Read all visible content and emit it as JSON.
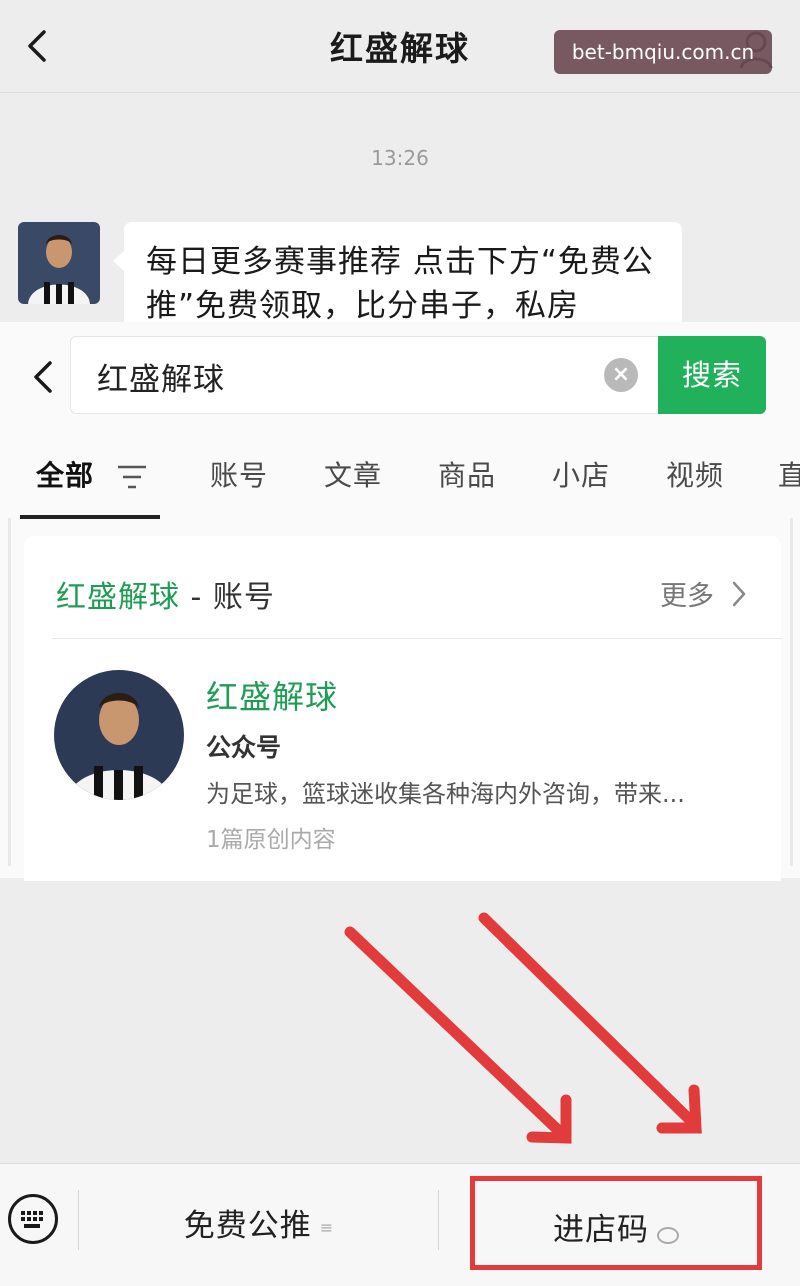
{
  "header": {
    "title": "红盛解球",
    "watermark": "bet-bmqiu.com.cn"
  },
  "chat": {
    "time": "13:26",
    "message": "每日更多赛事推荐 点击下方“免费公推”免费领取，比分串子，私房"
  },
  "search": {
    "query": "红盛解球",
    "clear_icon": "×",
    "button_label": "搜索",
    "tabs": [
      "全部",
      "账号",
      "文章",
      "商品",
      "小店",
      "视频",
      "直"
    ],
    "active_tab": "全部"
  },
  "result_card": {
    "title_highlight": "红盛解球",
    "title_suffix": " - 账号",
    "more_label": "更多",
    "account": {
      "name": "红盛解球",
      "type": "公众号",
      "description": "为足球，篮球迷收集各种海内外咨询，带来...",
      "stats": "1篇原创内容"
    }
  },
  "bottom_menu": {
    "item1": "免费公推",
    "item1_icon": "≡",
    "item2": "进店码"
  },
  "colors": {
    "accent_green": "#20b15a",
    "highlight_green": "#1f9d55",
    "annotation_red": "#e13b3b",
    "watermark_bg": "#6e4b55"
  }
}
